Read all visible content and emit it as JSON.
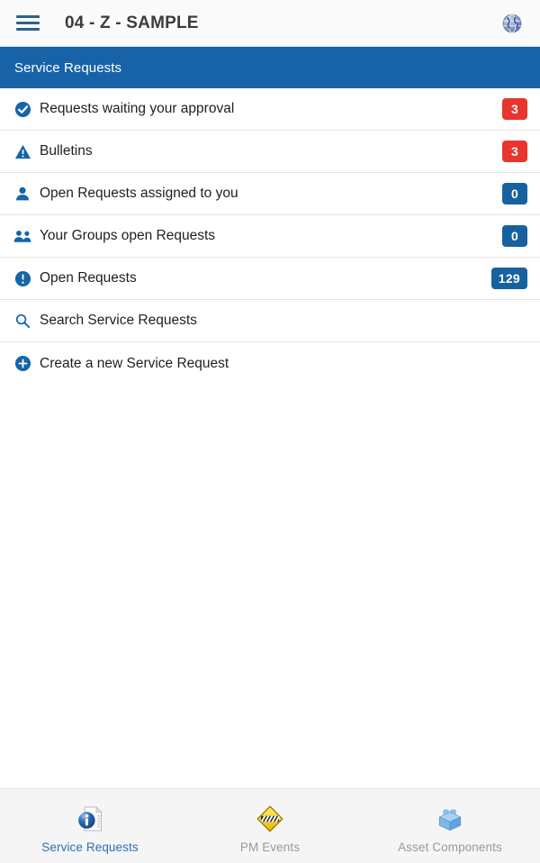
{
  "appbar": {
    "menu_icon": "hamburger-menu-icon",
    "title": "04 - Z - SAMPLE",
    "right_icon": "globe-icon"
  },
  "section": {
    "title": "Service Requests"
  },
  "colors": {
    "section_header_bg": "#1863a8",
    "badge_red": "#e8352d",
    "badge_blue": "#17629e",
    "icon_blue": "#1565a8",
    "active_tab": "#2a6fb8",
    "inactive_tab": "#9a9a9a",
    "appbar_bg": "#fafafa",
    "nav_bg": "#f5f5f5"
  },
  "list": {
    "rows": [
      {
        "icon": "check-circle-icon",
        "label": "Requests waiting your approval",
        "badge": "3",
        "badge_color": "red"
      },
      {
        "icon": "warning-triangle-icon",
        "label": "Bulletins",
        "badge": "3",
        "badge_color": "red"
      },
      {
        "icon": "person-icon",
        "label": "Open Requests assigned to you",
        "badge": "0",
        "badge_color": "blue"
      },
      {
        "icon": "people-group-icon",
        "label": "Your Groups open Requests",
        "badge": "0",
        "badge_color": "blue"
      },
      {
        "icon": "exclamation-circle-icon",
        "label": "Open Requests",
        "badge": "129",
        "badge_color": "blue"
      },
      {
        "icon": "search-icon",
        "label": "Search Service Requests",
        "badge": "",
        "badge_color": ""
      },
      {
        "icon": "plus-circle-icon",
        "label": "Create a new Service Request",
        "badge": "",
        "badge_color": ""
      }
    ]
  },
  "bottom_nav": {
    "tabs": [
      {
        "icon": "document-info-icon",
        "label": "Service Requests",
        "active": true
      },
      {
        "icon": "yellow-diamond-sign-icon",
        "label": "PM Events",
        "active": false
      },
      {
        "icon": "blue-brick-cube-icon",
        "label": "Asset Components",
        "active": false
      }
    ]
  }
}
